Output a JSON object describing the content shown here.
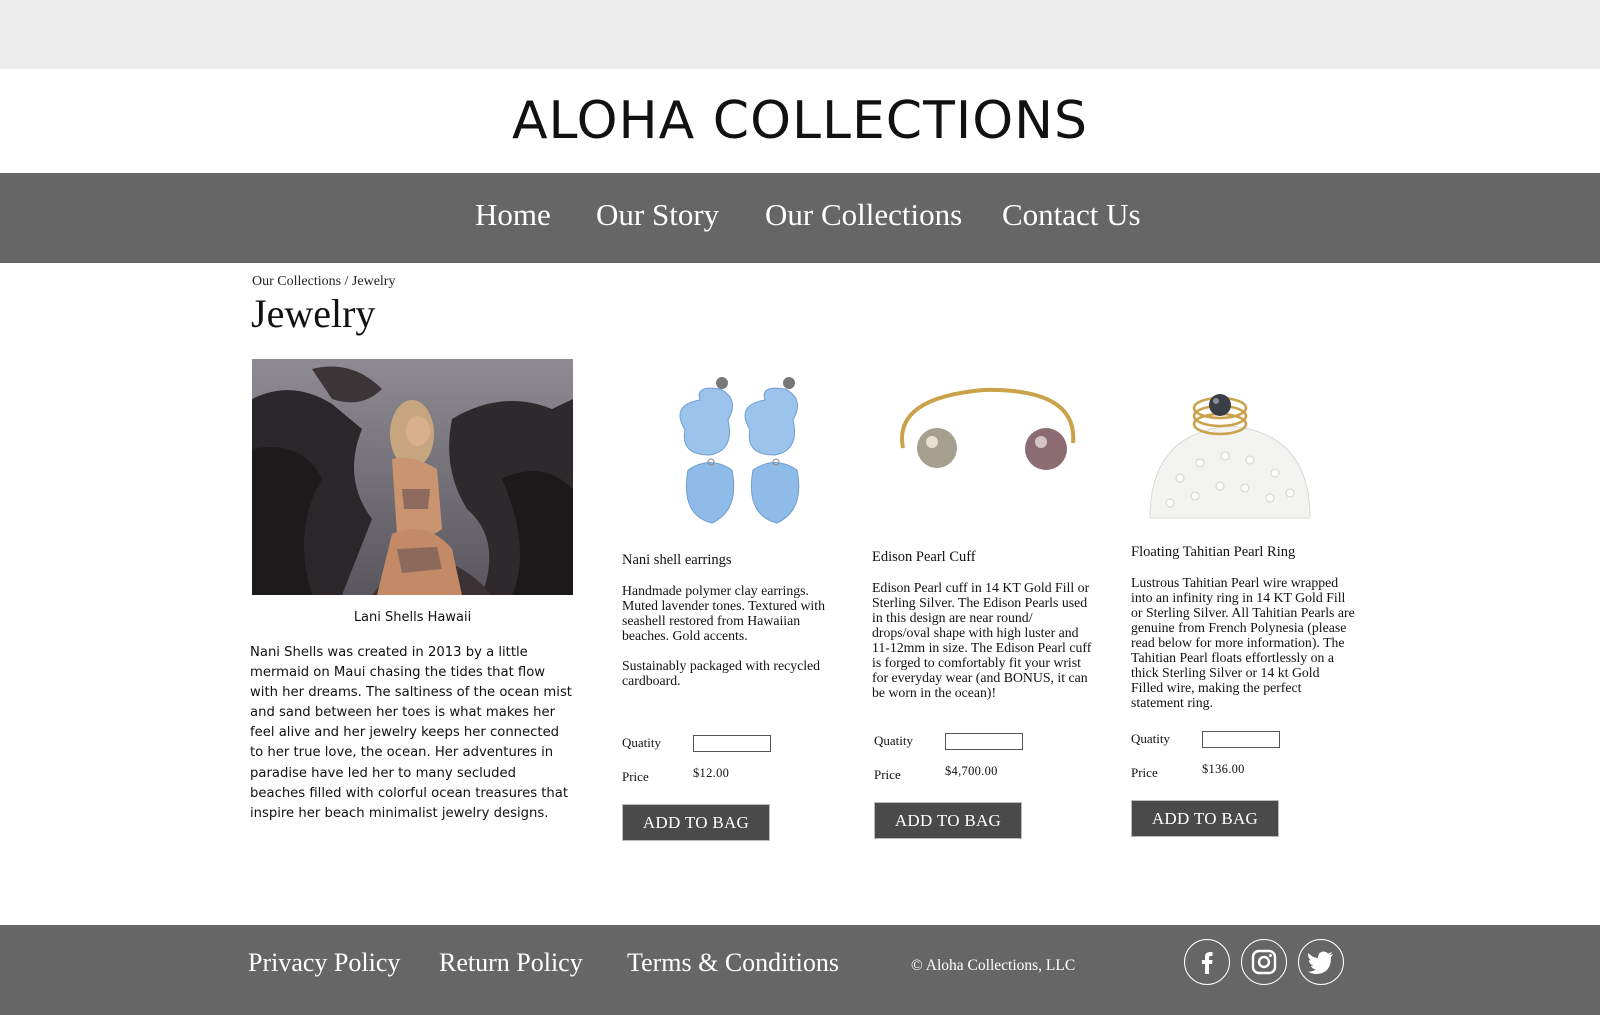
{
  "brand": {
    "title": "ALOHA COLLECTIONS"
  },
  "nav": {
    "items": [
      "Home",
      "Our Story",
      "Our Collections",
      "Contact Us"
    ]
  },
  "breadcrumb": "Our Collections / Jewelry",
  "page_title": "Jewelry",
  "feature": {
    "caption": "Lani Shells Hawaii",
    "about": "Nani Shells was created in 2013 by a little mermaid on Maui chasing the tides that flow with her dreams. The saltiness of the ocean mist and sand between her toes is what makes her feel alive and her jewelry keeps her connected to her true love, the ocean. Her adventures in paradise have led her to many secluded beaches filled with colorful ocean treasures that inspire her beach minimalist jewelry designs."
  },
  "form_labels": {
    "quantity": "Quatity",
    "price": "Price",
    "add_button": "ADD TO BAG"
  },
  "products": [
    {
      "name": "Nani shell earrings",
      "description": [
        "Handmade polymer clay earrings. Muted lavender tones. Textured with seashell restored from Hawaiian beaches. Gold accents.",
        "Sustainably packaged with recycled cardboard."
      ],
      "price": "$12.00",
      "image": "blue-shell-earrings-image"
    },
    {
      "name": "Edison Pearl Cuff",
      "description": [
        "Edison Pearl cuff in 14 KT Gold Fill or Sterling Silver. The Edison Pearls used in this design are near round/ drops/oval shape with high luster and 11-12mm in size. The Edison Pearl cuff is forged to comfortably fit your wrist for everyday wear (and BONUS, it can be worn in the ocean)!"
      ],
      "price": "$4,700.00",
      "image": "pearl-cuff-image"
    },
    {
      "name": "Floating Tahitian Pearl Ring",
      "description": [
        "Lustrous Tahitian Pearl wire wrapped into an infinity ring in 14 KT Gold Fill or Sterling Silver. All Tahitian Pearls are genuine from French Polynesia (please read below for more information). The Tahitian Pearl floats effortlessly on a thick Sterling Silver or 14 kt Gold Filled wire, making the perfect statement ring."
      ],
      "price": "$136.00",
      "image": "tahitian-pearl-ring-image"
    }
  ],
  "footer": {
    "links": [
      "Privacy Policy",
      "Return Policy",
      "Terms & Conditions"
    ],
    "copyright": "© Aloha Collections, LLC",
    "social": [
      "facebook-icon",
      "instagram-icon",
      "twitter-icon"
    ]
  },
  "colors": {
    "topbar": "#ededed",
    "nav_bg": "#666666",
    "footer_bg": "#666666",
    "button_bg": "#4a4a4a"
  }
}
